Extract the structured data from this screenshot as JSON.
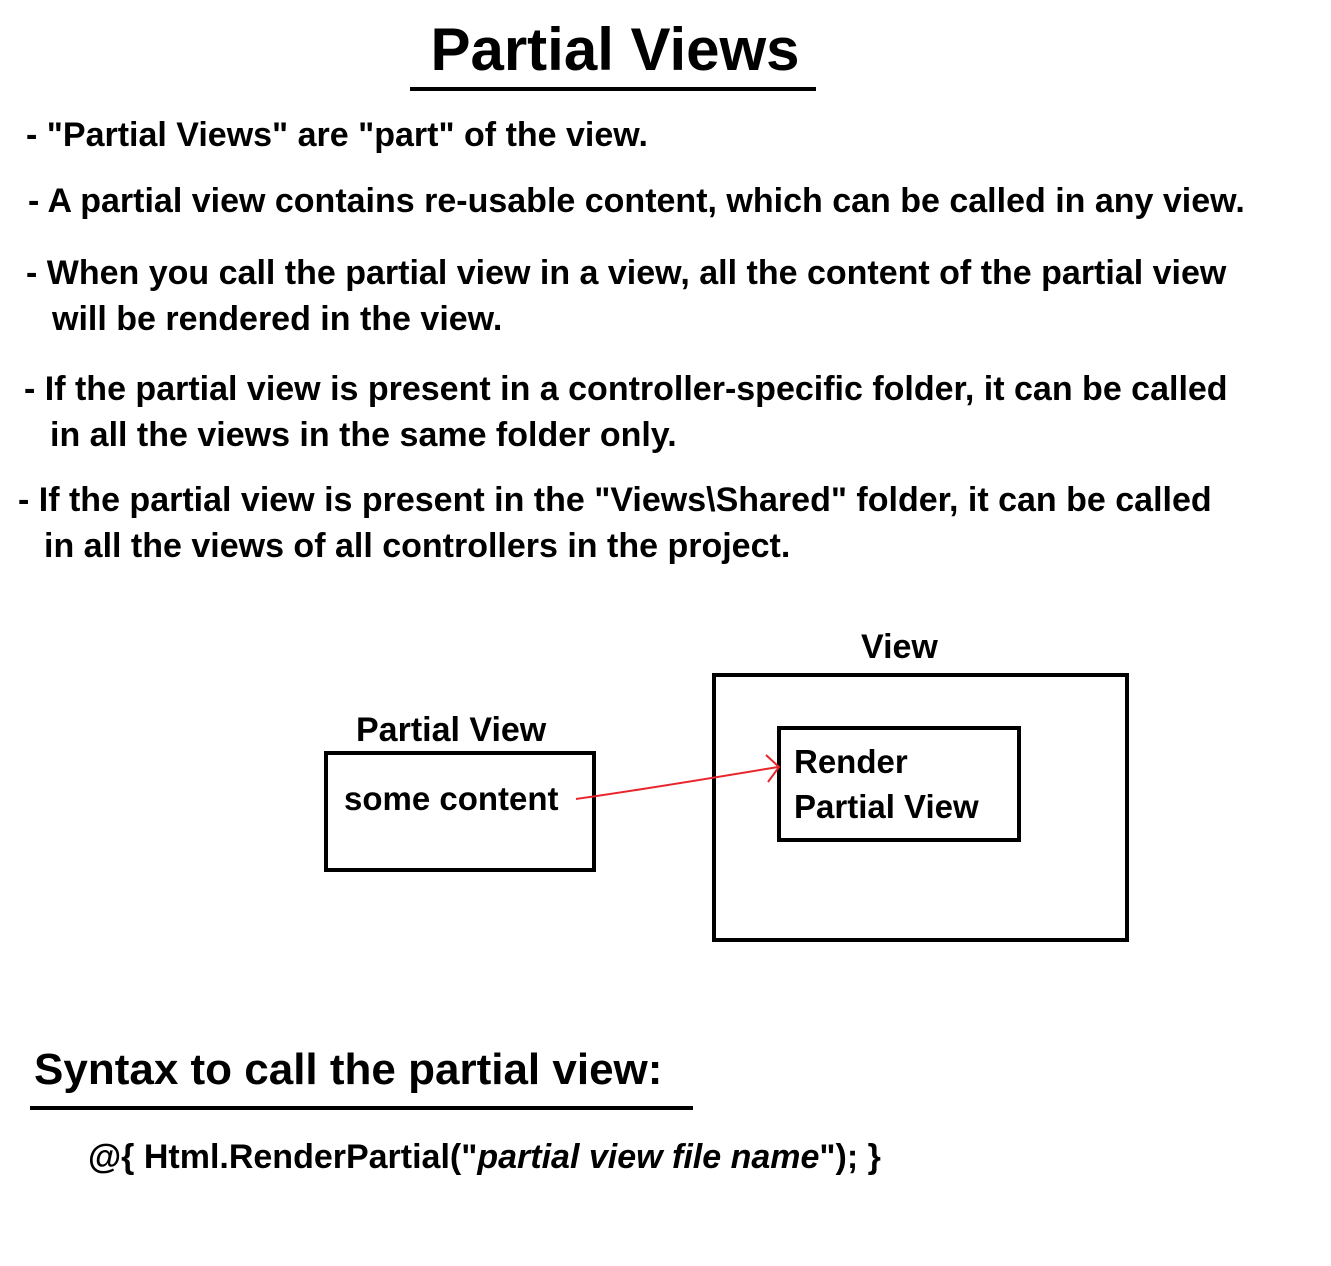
{
  "title": "Partial Views",
  "bullets": [
    {
      "lines": [
        "- \"Partial Views\" are \"part\" of the view."
      ]
    },
    {
      "lines": [
        "- A partial view contains re-usable content, which can be called in any view."
      ]
    },
    {
      "lines": [
        "- When you call the partial view in a view, all the content of the partial view",
        "will be rendered in the view."
      ]
    },
    {
      "lines": [
        "- If the partial view is present in a controller-specific folder, it can be called",
        "in all the views in the same folder only."
      ]
    },
    {
      "lines": [
        "- If the partial view is present in the \"Views\\Shared\" folder, it can be called",
        "in all the views of all controllers in the project."
      ]
    }
  ],
  "diagram": {
    "partial_view": {
      "label": "Partial View",
      "content": "some content"
    },
    "view": {
      "label": "View",
      "inner_lines": [
        "Render",
        "Partial View"
      ]
    },
    "arrow_color": "#e8252b"
  },
  "syntax": {
    "heading": "Syntax to call the partial view:",
    "code_prefix": "@{ Html.RenderPartial(\"",
    "code_param": "partial view file name",
    "code_suffix": "\"); }"
  }
}
